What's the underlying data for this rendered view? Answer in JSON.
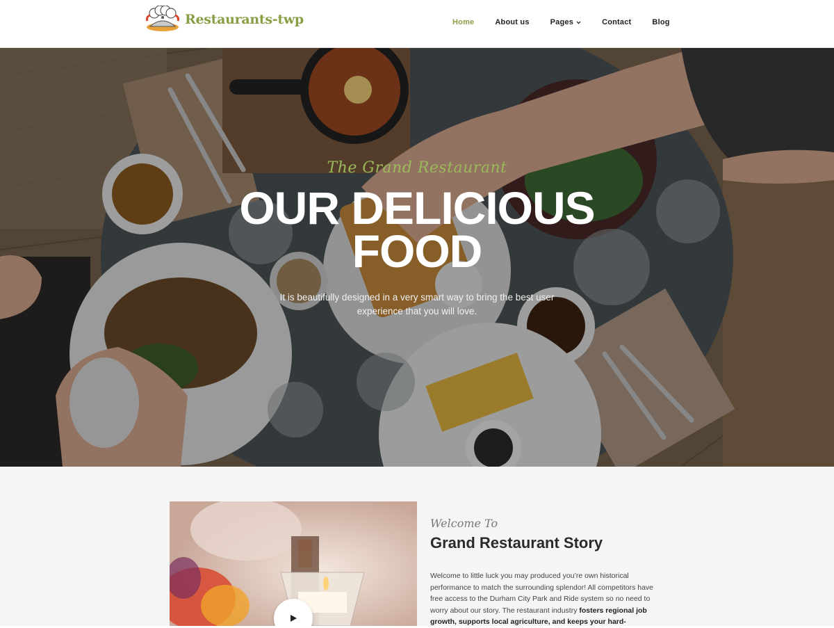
{
  "brand": {
    "name": "Restaurants-twp"
  },
  "nav": {
    "items": [
      {
        "label": "Home",
        "active": true
      },
      {
        "label": "About us",
        "active": false
      },
      {
        "label": "Pages",
        "active": false,
        "dropdown": true
      },
      {
        "label": "Contact",
        "active": false
      },
      {
        "label": "Blog",
        "active": false
      }
    ]
  },
  "hero": {
    "kicker": "The Grand Restaurant",
    "title_line1": "OUR DELICIOUS",
    "title_line2": "FOOD",
    "subtitle": "It is beautifully designed in a very smart way to bring the best user experience that you will love."
  },
  "story": {
    "kicker": "Welcome To",
    "title": "Grand Restaurant Story",
    "body_plain": "Welcome to little luck you may produced you’re own historical performance to match the surrounding splendor! All competitors have free access to the Durham City Park and Ride system so no need to worry about our story. The restaurant industry ",
    "body_bold": "fosters regional job growth, supports local agriculture, and keeps your hard-"
  },
  "colors": {
    "accent": "#8a9e46",
    "hero_kicker": "#9bb95b",
    "section_bg": "#f5f5f5"
  },
  "icons": {
    "logo": "chef-hat-logo-icon",
    "dropdown": "chevron-down-icon",
    "play": "play-icon"
  }
}
